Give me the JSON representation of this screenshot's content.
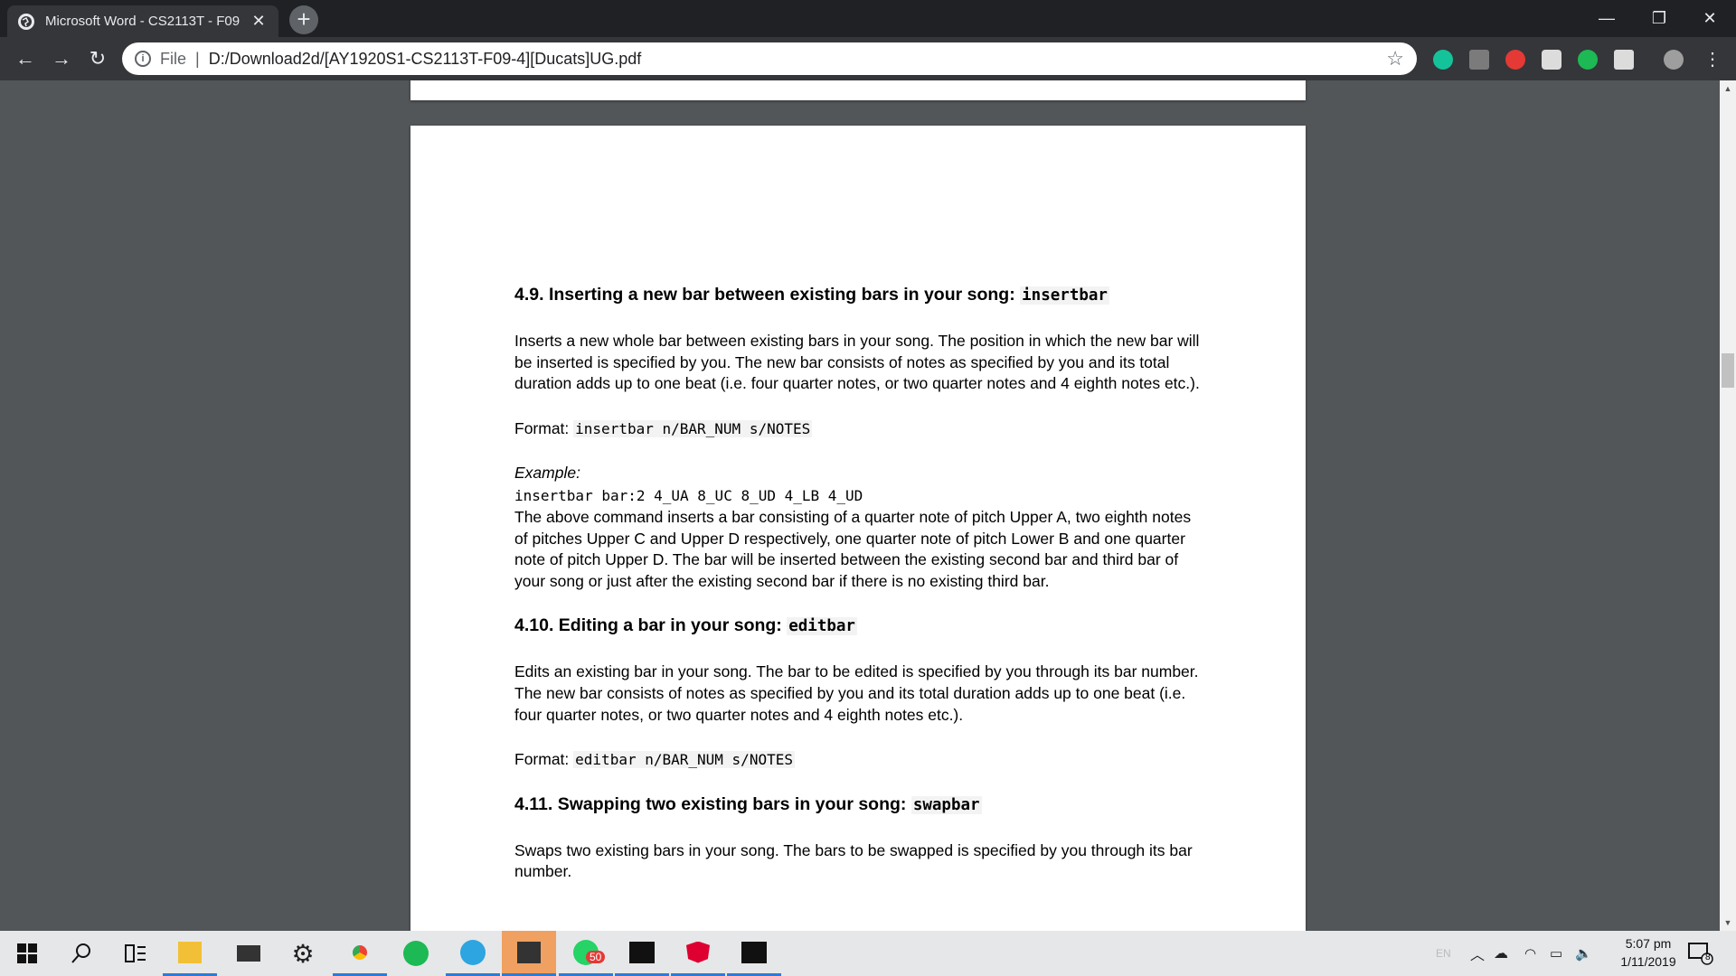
{
  "browser": {
    "tab_title": "Microsoft Word - CS2113T - F09",
    "tab_close": "✕",
    "new_tab": "+",
    "window_controls": {
      "minimize": "—",
      "restore": "❐",
      "close": "✕"
    },
    "nav": {
      "back": "←",
      "forward": "→",
      "reload": "↻"
    },
    "address": {
      "info": "i",
      "scheme": "File",
      "separator": "|",
      "url": "D:/Download2d/[AY1920S1-CS2113T-F09-4][Ducats]UG.pdf",
      "star": "☆"
    },
    "extensions": [
      {
        "name": "grammarly-icon",
        "color": "#15c39a"
      },
      {
        "name": "extension-square-icon",
        "color": "#7b7b7b"
      },
      {
        "name": "adblock-icon",
        "color": "#e53935"
      },
      {
        "name": "shield-icon",
        "color": "#dcdcdc"
      },
      {
        "name": "green-dot-icon",
        "color": "#1db954"
      },
      {
        "name": "calculator-icon",
        "color": "#dcdcdc"
      }
    ],
    "menu": "⋮"
  },
  "document": {
    "sections": [
      {
        "heading": "4.9. Inserting a new bar between existing bars in your song: ",
        "heading_code": "insertbar",
        "body": "Inserts a new whole bar between existing bars in your song. The position in which the new bar will be inserted is specified by you. The new bar consists of notes as specified by you and its total duration adds up to one beat (i.e. four quarter notes, or two quarter notes and 4 eighth notes etc.).",
        "format_label": "Format: ",
        "format_code": "insertbar n/BAR_NUM s/NOTES",
        "example_label": "Example:",
        "example_code": "insertbar bar:2 4_UA 8_UC 8_UD 4_LB 4_UD",
        "example_desc": "The above command inserts a bar consisting of a quarter note of pitch Upper A, two eighth notes of pitches Upper C and Upper D respectively, one quarter note of pitch Lower B and one quarter note of pitch Upper D. The bar will be inserted between the existing second bar and third bar of your song or just after the existing second bar if there is no existing third bar."
      },
      {
        "heading": "4.10. Editing a bar in your song: ",
        "heading_code": "editbar",
        "body": "Edits an existing bar in your song. The bar to be edited is specified by you through its bar number. The new bar consists of notes as specified by you and its total duration adds up to one beat (i.e. four quarter notes, or two quarter notes and 4 eighth notes etc.).",
        "format_label": "Format: ",
        "format_code": "editbar n/BAR_NUM s/NOTES"
      },
      {
        "heading": "4.11. Swapping two existing bars in your song: ",
        "heading_code": "swapbar",
        "body": "Swaps two existing bars in your song. The bars to be swapped is specified by you through its bar number."
      }
    ]
  },
  "taskbar": {
    "whatsapp_badge": "50",
    "tray_lang": "EN",
    "time": "5:07 pm",
    "date": "1/11/2019",
    "notification_count": "8"
  }
}
